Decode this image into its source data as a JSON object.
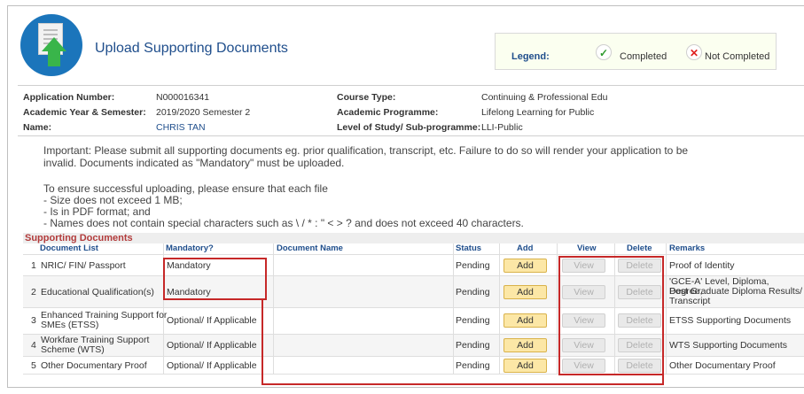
{
  "header": {
    "title": "Upload Supporting Documents",
    "icon": "upload-document-icon"
  },
  "legend": {
    "label": "Legend:",
    "completed_label": "Completed",
    "not_completed_label": "Not Completed",
    "completed_icon": "checkmark-icon",
    "not_completed_icon": "cross-icon"
  },
  "info": {
    "application_number_label": "Application Number:",
    "application_number": "N000016341",
    "academic_year_label": "Academic Year & Semester:",
    "academic_year": "2019/2020 Semester 2",
    "name_label": "Name:",
    "name": "CHRIS TAN",
    "course_type_label": "Course Type:",
    "course_type": "Continuing & Professional Edu",
    "academic_programme_label": "Academic Programme:",
    "academic_programme": "Lifelong Learning for Public",
    "level_label": "Level of Study/ Sub-programme:",
    "level": "LLI-Public"
  },
  "notes": {
    "important_1": "Important: Please submit all supporting documents eg. prior qualification, transcript, etc. Failure to do so will render your application to be",
    "important_2": "invalid. Documents indicated as \"Mandatory\" must be uploaded.",
    "ensure": "To ensure successful uploading, please ensure that each file",
    "b1": "- Size does not exceed 1 MB;",
    "b2": "- Is in PDF format; and",
    "b3": "- Names does not contain special characters such as \\ / * : \" < > ? and does not exceed 40 characters."
  },
  "table": {
    "section_title": "Supporting Documents",
    "columns": [
      "Document List",
      "Mandatory?",
      "Document Name",
      "Status",
      "Add",
      "View",
      "Delete",
      "Remarks"
    ],
    "rows": [
      {
        "num": "1",
        "doc1": "NRIC/ FIN/ Passport",
        "doc2": "",
        "mandatory": "Mandatory",
        "name": "",
        "status": "Pending",
        "add": "Add",
        "view": "View",
        "delete": "Delete",
        "r1": "Proof of Identity",
        "r2": "",
        "r3": ""
      },
      {
        "num": "2",
        "doc1": "Educational Qualification(s)",
        "doc2": "",
        "mandatory": "Mandatory",
        "name": "",
        "status": "Pending",
        "add": "Add",
        "view": "View",
        "delete": "Delete",
        "r1": "'GCE-A' Level, Diploma, Degree,",
        "r2": "Post Graduate Diploma Results/",
        "r3": "Transcript"
      },
      {
        "num": "3",
        "doc1": "Enhanced Training Support for",
        "doc2": "SMEs (ETSS)",
        "mandatory": "Optional/ If Applicable",
        "name": "",
        "status": "Pending",
        "add": "Add",
        "view": "View",
        "delete": "Delete",
        "r1": "ETSS Supporting Documents",
        "r2": "",
        "r3": ""
      },
      {
        "num": "4",
        "doc1": "Workfare Training Support",
        "doc2": "Scheme (WTS)",
        "mandatory": "Optional/ If Applicable",
        "name": "",
        "status": "Pending",
        "add": "Add",
        "view": "View",
        "delete": "Delete",
        "r1": "WTS Supporting Documents",
        "r2": "",
        "r3": ""
      },
      {
        "num": "5",
        "doc1": "Other Documentary Proof",
        "doc2": "",
        "mandatory": "Optional/ If Applicable",
        "name": "",
        "status": "Pending",
        "add": "Add",
        "view": "View",
        "delete": "Delete",
        "r1": "Other Documentary Proof",
        "r2": "",
        "r3": ""
      }
    ]
  },
  "colors": {
    "title": "#1f4e8c",
    "section_title": "#b23b3b",
    "highlight": "#c62828",
    "add_button": "#fce7a6"
  }
}
